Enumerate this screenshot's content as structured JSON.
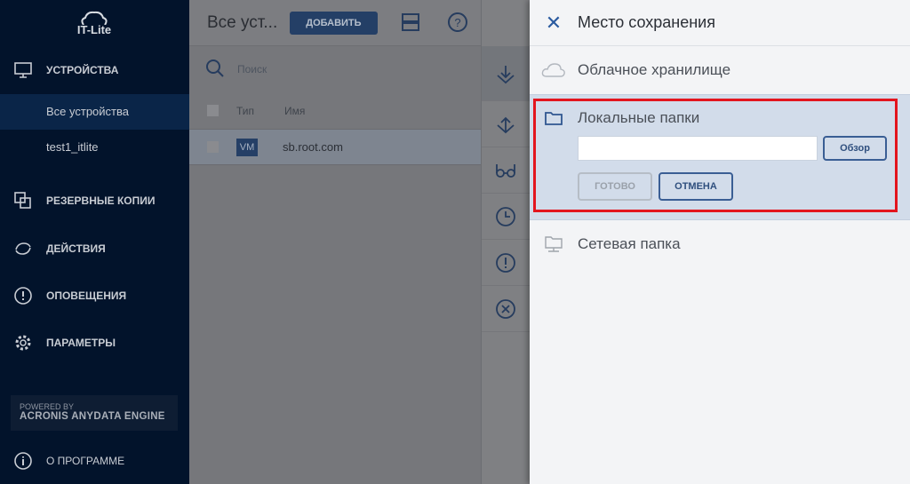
{
  "sidebar": {
    "logo": "IT-Lite",
    "section_devices": "УСТРОЙСТВА",
    "items": [
      {
        "label": "Все устройства"
      },
      {
        "label": "test1_itlite"
      }
    ],
    "backups": "РЕЗЕРВНЫЕ КОПИИ",
    "actions": "ДЕЙСТВИЯ",
    "alerts": "ОПОВЕЩЕНИЯ",
    "settings": "ПАРАМЕТРЫ",
    "powered_by": "POWERED BY",
    "engine": "ACRONIS ANYDATA ENGINE",
    "about": "О ПРОГРАММЕ"
  },
  "main": {
    "title": "Все уст...",
    "add_label": "ДОБАВИТЬ",
    "search_placeholder": "Поиск",
    "col_type": "Тип",
    "col_name": "Имя",
    "rows": [
      {
        "type": "VM",
        "name": "sb.root.com"
      }
    ]
  },
  "panel": {
    "title": "Место сохранения",
    "cloud": "Облачное хранилище",
    "local": "Локальные папки",
    "path_value": "",
    "browse": "Обзор",
    "done": "ГОТОВО",
    "cancel": "ОТМЕНА",
    "network": "Сетевая папка"
  },
  "colors": {
    "accent": "#2b5ba0",
    "highlight": "#e3151e"
  }
}
